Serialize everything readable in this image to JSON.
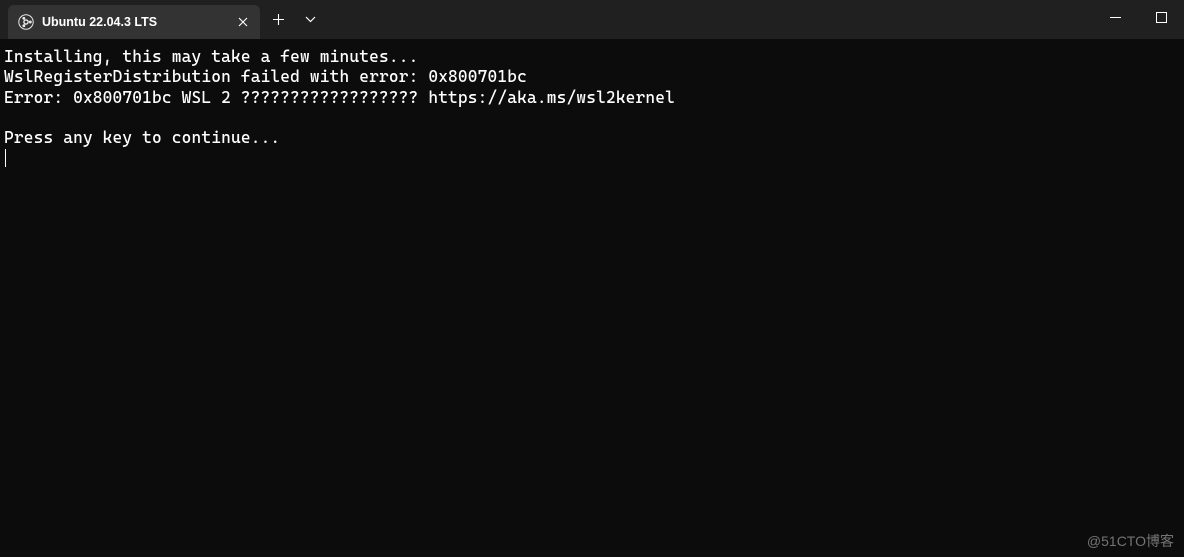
{
  "tab": {
    "title": "Ubuntu 22.04.3 LTS",
    "icon_name": "ubuntu-icon"
  },
  "titlebar": {
    "new_tab_label": "+",
    "dropdown_label": "⌄"
  },
  "terminal": {
    "line1": "Installing, this may take a few minutes...",
    "line2": "WslRegisterDistribution failed with error: 0x800701bc",
    "line3": "Error: 0x800701bc WSL 2 ?????????????????? https://aka.ms/wsl2kernel",
    "blank_line": "",
    "line4": "Press any key to continue..."
  },
  "watermark": "@51CTO博客"
}
